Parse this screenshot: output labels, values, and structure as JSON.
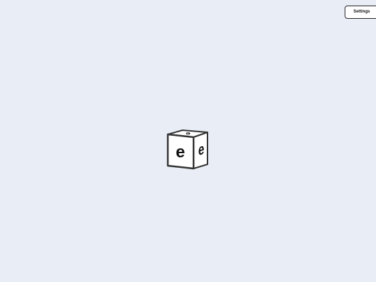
{
  "toolbar": {
    "settings_label": "Settings"
  },
  "cube": {
    "front_letter": "e",
    "right_letter": "e",
    "top_letter": "e",
    "face_color": "#ffffff",
    "edge_color": "#333333"
  },
  "colors": {
    "background": "#e8edf6"
  }
}
